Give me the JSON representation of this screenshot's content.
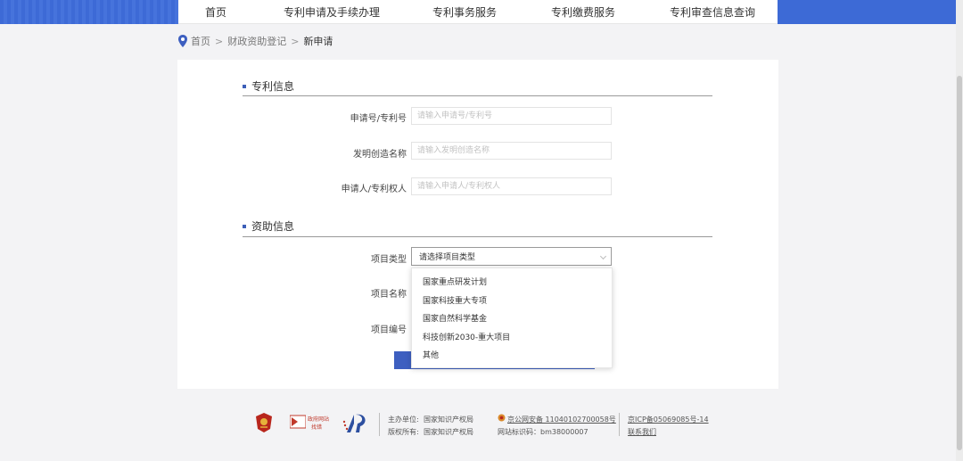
{
  "nav": {
    "items": [
      "首页",
      "专利申请及手续办理",
      "专利事务服务",
      "专利缴费服务",
      "专利审查信息查询"
    ]
  },
  "breadcrumb": {
    "home": "首页",
    "parent": "财政资助登记",
    "current": "新申请",
    "separator": ">"
  },
  "patent_section": {
    "title": "专利信息",
    "fields": [
      {
        "label": "申请号/专利号",
        "placeholder": "请输入申请号/专利号",
        "value": ""
      },
      {
        "label": "发明创造名称",
        "placeholder": "请输入发明创造名称",
        "value": ""
      },
      {
        "label": "申请人/专利权人",
        "placeholder": "请输入申请人/专利权人",
        "value": ""
      }
    ]
  },
  "funding_section": {
    "title": "资助信息",
    "project_type_label": "项目类型",
    "project_type_value": "请选择项目类型",
    "project_name_label": "项目名称",
    "project_number_label": "项目编号",
    "options": [
      "国家重点研发计划",
      "国家科技重大专项",
      "国家自然科学基金",
      "科技创新2030-重大项目",
      "其他"
    ]
  },
  "footer": {
    "logo2_text": "政府网站",
    "logo2_sub": "找错",
    "host_label": "主办单位:",
    "host_value": "国家知识产权局",
    "copyright_label": "版权所有:",
    "copyright_value": "国家知识产权局",
    "police_record": "京公网安备 11040102700058号",
    "site_id": "网站标识码：bm38000007",
    "icp": "京ICP备05069085号-14",
    "contact": "联系我们"
  },
  "colors": {
    "brand_blue": "#3d6ad6",
    "button_blue": "#3d5fc0"
  }
}
